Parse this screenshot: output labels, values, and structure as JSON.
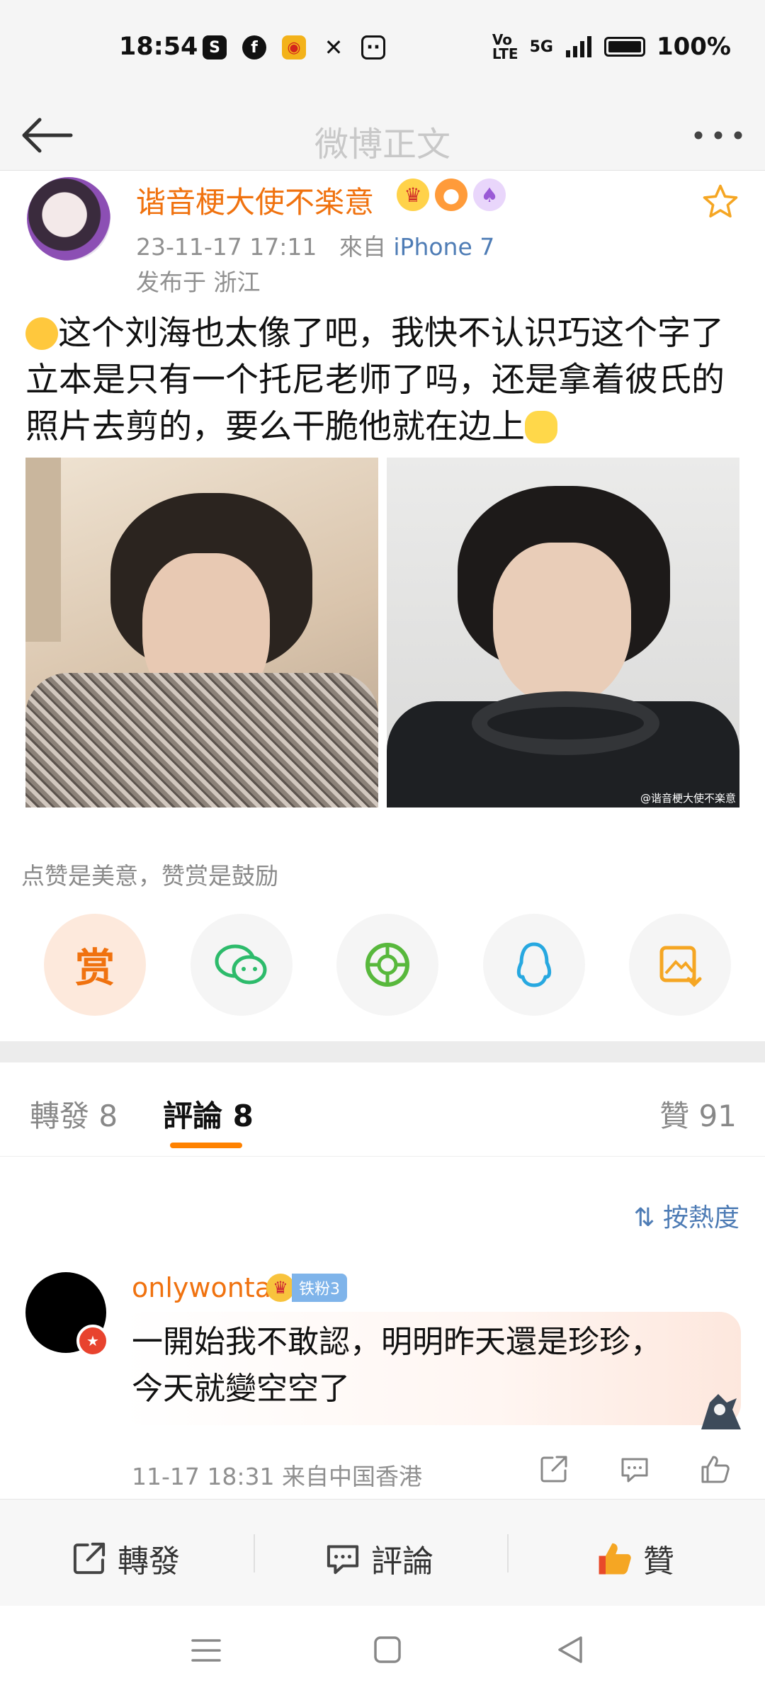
{
  "status_bar": {
    "time": "18:54",
    "network": "5G",
    "battery": "100%",
    "app_icons": [
      "shopping-bag-icon",
      "facebook-icon",
      "weibo-icon",
      "x-icon",
      "bilibili-icon"
    ]
  },
  "header": {
    "title": "微博正文"
  },
  "post": {
    "author": "谐音梗大使不楽意",
    "time": "23-11-17 17:11",
    "source_prefix": "來自",
    "device": "iPhone 7",
    "location": "发布于 浙江",
    "text_lines": [
      "这个刘海也太像了吧，我快不认识巧这个字了",
      "立本是只有一个托尼老师了吗，还是拿着彼氏的",
      "照片去剪的，要么干脆他就在边上"
    ],
    "watermark": "@谐音梗大使不楽意"
  },
  "reward": {
    "text": "点赞是美意，赞赏是鼓励",
    "reward_label": "赏"
  },
  "tabs": {
    "repost": "轉發 8",
    "comment": "評論 8",
    "like": "贊 91",
    "sort": "按熱度"
  },
  "comment": {
    "user": "onlywonta",
    "fan_level": "铁粉3",
    "text_lines": [
      "一開始我不敢認，明明昨天還是珍珍，",
      "今天就變空空了"
    ],
    "meta": "11-17 18:31  来自中国香港"
  },
  "bottom_bar": {
    "repost": "轉發",
    "comment": "評論",
    "like": "贊"
  },
  "colors": {
    "accent": "#ff8200",
    "username": "#f0720f",
    "link": "#4e7cb5"
  }
}
